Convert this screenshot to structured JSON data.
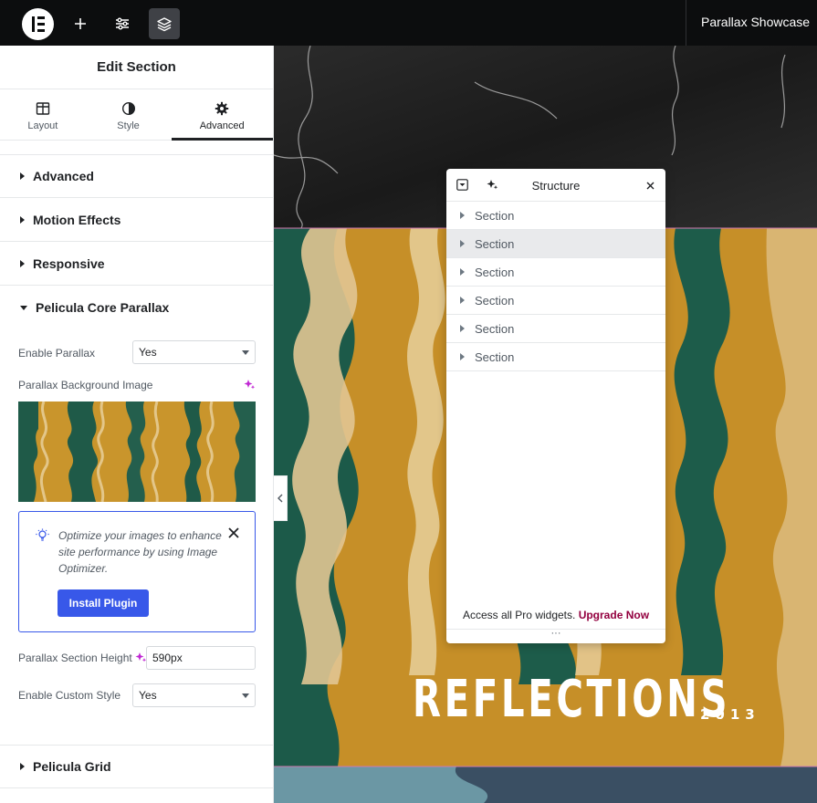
{
  "topbar": {
    "site_title": "Parallax Showcase",
    "buttons": [
      "elementor-logo-icon",
      "add-icon",
      "sliders-icon",
      "layers-icon"
    ]
  },
  "panel": {
    "title": "Edit Section",
    "tabs": [
      {
        "label": "Layout",
        "icon": "layout-icon"
      },
      {
        "label": "Style",
        "icon": "contrast-icon"
      },
      {
        "label": "Advanced",
        "icon": "gear-icon",
        "active": true
      }
    ],
    "sections": {
      "advanced": "Advanced",
      "motion": "Motion Effects",
      "responsive": "Responsive",
      "parallax": "Pelicula Core Parallax",
      "grid": "Pelicula Grid"
    },
    "controls": {
      "enable_parallax_label": "Enable Parallax",
      "enable_parallax_value": "Yes",
      "bg_image_label": "Parallax Background Image",
      "notice_text": "Optimize your images to enhance site performance by using Image Optimizer.",
      "install_label": "Install Plugin",
      "height_label": "Parallax Section Height",
      "height_value": "590px",
      "custom_style_label": "Enable Custom Style",
      "custom_style_value": "Yes"
    }
  },
  "structure": {
    "title": "Structure",
    "rows": [
      "Section",
      "Section",
      "Section",
      "Section",
      "Section",
      "Section"
    ],
    "highlighted_index": 1,
    "footer_text": "Access all Pro widgets.",
    "upgrade_label": "Upgrade Now",
    "handle": "···"
  },
  "canvas": {
    "headline": "REFLECTIONS",
    "year": "2013"
  },
  "colors": {
    "accent_blue": "#3858e9",
    "upgrade_color": "#93003f",
    "ai_purple": "#c026d3",
    "topbar_bg": "#0c0d0e"
  }
}
